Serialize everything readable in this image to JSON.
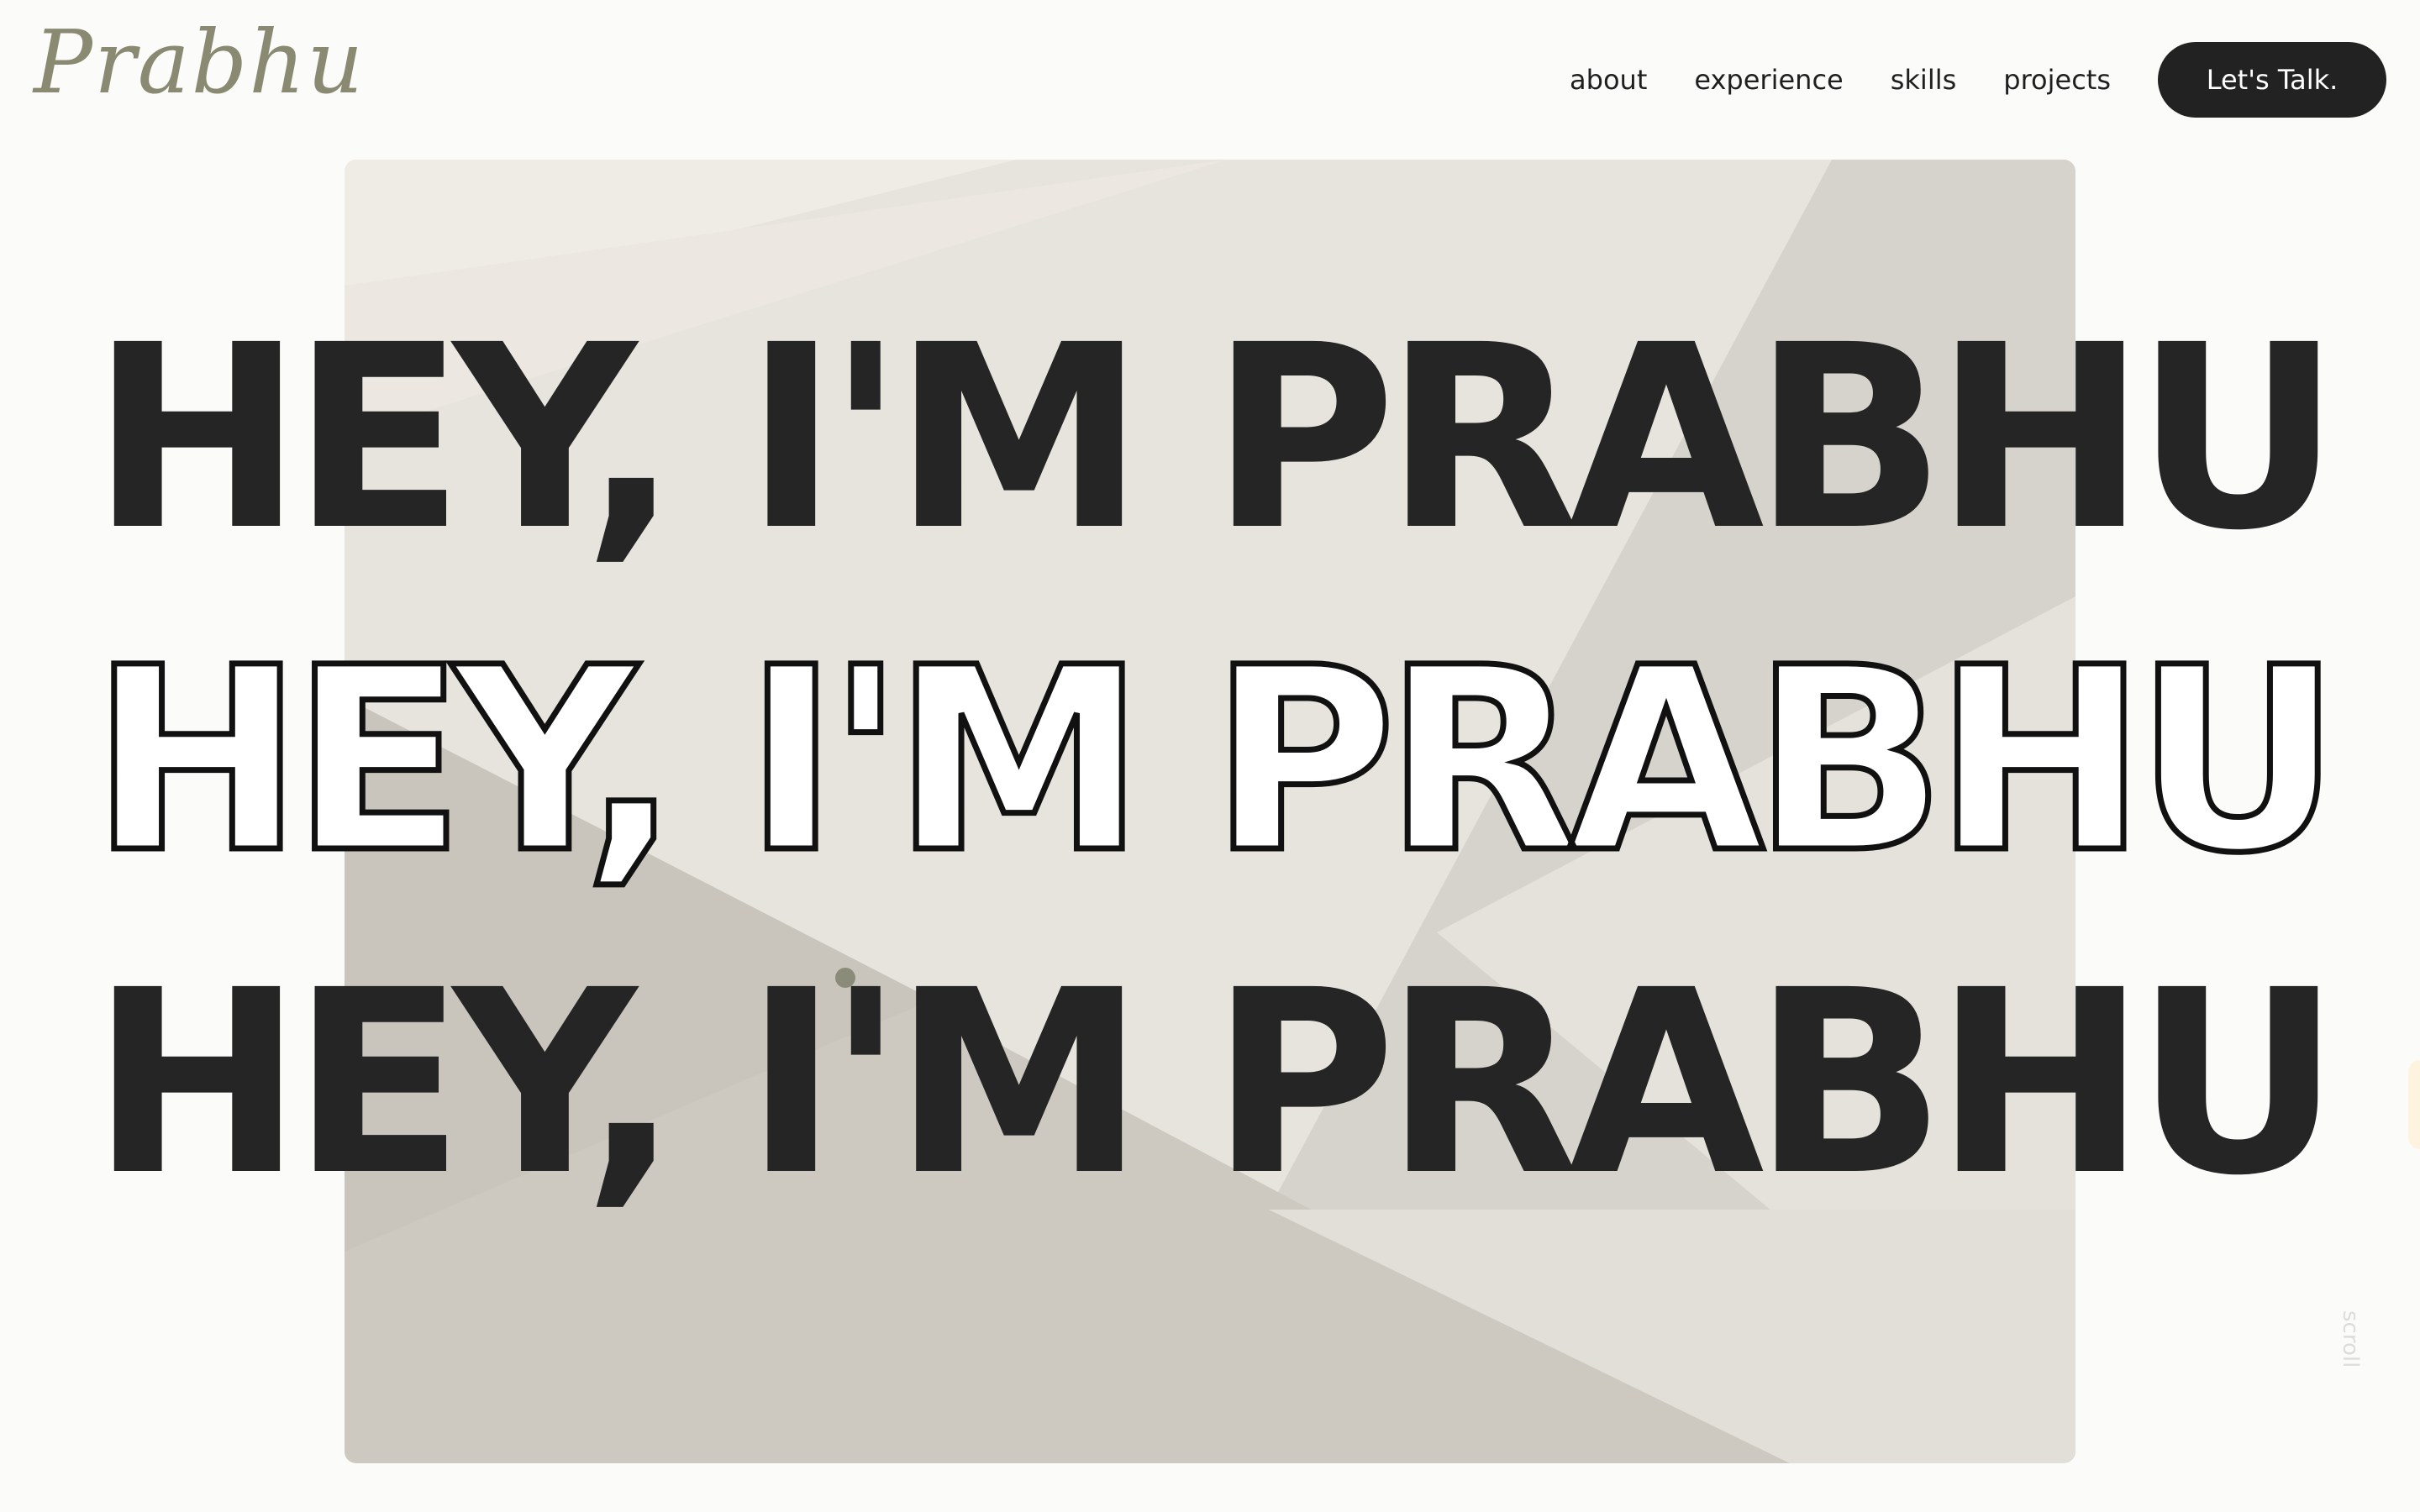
{
  "header": {
    "logo_text": "Prabhu",
    "nav": [
      "about",
      "experience",
      "skills",
      "projects"
    ],
    "cta_label": "Let's Talk."
  },
  "hero": {
    "headline_lines": [
      "HEY, I'M PRABHU",
      "HEY, I'M PRABHU",
      "HEY, I'M PRABHU"
    ],
    "scroll_label": "scroll"
  },
  "colors": {
    "page_background": "#fbfbfa",
    "hero_background": "#e7e4de",
    "text_dark": "#252525",
    "logo": "#8a8a72",
    "cta_background": "#222222"
  },
  "icons": [
    "cursor-dot"
  ]
}
